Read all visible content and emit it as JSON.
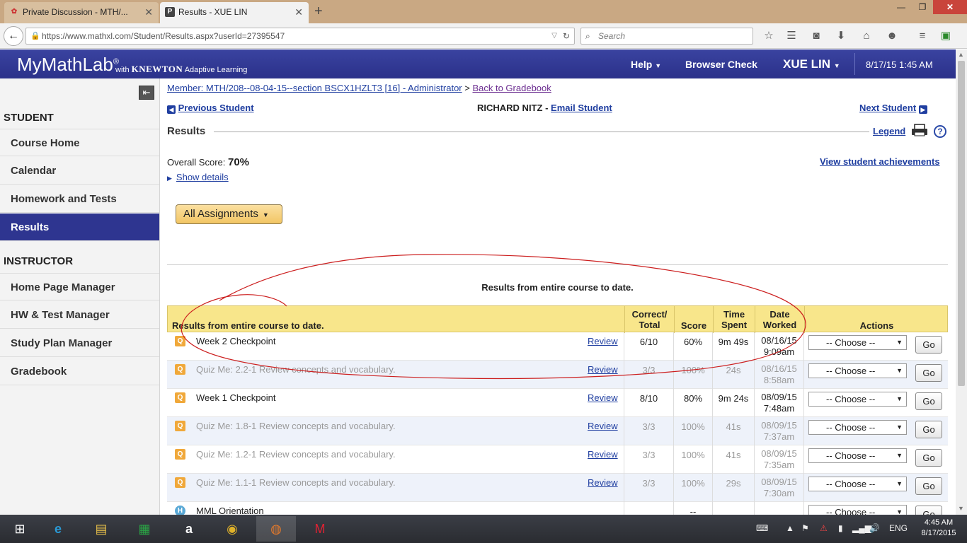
{
  "browser": {
    "tabs": [
      {
        "label": "Private Discussion - MTH/..."
      },
      {
        "label": "Results - XUE LIN"
      }
    ],
    "url": "https://www.mathxl.com/Student/Results.aspx?userId=27395547",
    "search_placeholder": "Search"
  },
  "header": {
    "logo": "MyMathLab",
    "logo_reg": "®",
    "logo_with": "with",
    "logo_knewton": "KNEWTON",
    "logo_adaptive": "Adaptive Learning",
    "help": "Help",
    "browser_check": "Browser Check",
    "user": "XUE LIN",
    "datetime": "8/17/15 1:45 AM"
  },
  "sidebar": {
    "student_title": "STUDENT",
    "student_items": [
      {
        "label": "Course Home"
      },
      {
        "label": "Calendar"
      },
      {
        "label": "Homework and Tests"
      },
      {
        "label": "Results"
      }
    ],
    "instructor_title": "INSTRUCTOR",
    "instructor_items": [
      {
        "label": "Home Page Manager"
      },
      {
        "label": "HW & Test Manager"
      },
      {
        "label": "Study Plan Manager"
      },
      {
        "label": "Gradebook"
      }
    ]
  },
  "main": {
    "member_link": "Member: MTH/208--08-04-15--section BSCX1HZLT3 [16] - Administrator",
    "member_sep": ">",
    "back_link": "Back to Gradebook",
    "prev_student": "Previous Student",
    "student_name": "RICHARD NITZ",
    "name_sep": "-",
    "email_student": "Email Student",
    "next_student": "Next Student",
    "title": "Results",
    "legend": "Legend",
    "overall_label": "Overall Score:",
    "overall_value": "70%",
    "achievements": "View student achievements",
    "show_details": "Show details",
    "assignments_btn": "All Assignments",
    "caption": "Results from entire course to date."
  },
  "table": {
    "headers": {
      "name": "Results from entire course to date.",
      "correct": "Correct/ Total",
      "score": "Score",
      "time": "Time Spent",
      "date": "Date Worked",
      "actions": "Actions"
    },
    "review_label": "Review",
    "choose_label": "-- Choose --",
    "go_label": "Go",
    "rows": [
      {
        "icon": "Q",
        "name": "Week 2 Checkpoint",
        "correct": "6/10",
        "score": "60%",
        "time": "9m 49s",
        "date1": "08/16/15",
        "date2": "9:09am"
      },
      {
        "icon": "Q",
        "name": "Quiz Me: 2.2-1 Review concepts and vocabulary.",
        "correct": "3/3",
        "score": "100%",
        "time": "24s",
        "date1": "08/16/15",
        "date2": "8:58am"
      },
      {
        "icon": "Q",
        "name": "Week 1 Checkpoint",
        "correct": "8/10",
        "score": "80%",
        "time": "9m 24s",
        "date1": "08/09/15",
        "date2": "7:48am"
      },
      {
        "icon": "Q",
        "name": "Quiz Me: 1.8-1 Review concepts and vocabulary.",
        "correct": "3/3",
        "score": "100%",
        "time": "41s",
        "date1": "08/09/15",
        "date2": "7:37am"
      },
      {
        "icon": "Q",
        "name": "Quiz Me: 1.2-1 Review concepts and vocabulary.",
        "correct": "3/3",
        "score": "100%",
        "time": "41s",
        "date1": "08/09/15",
        "date2": "7:35am"
      },
      {
        "icon": "Q",
        "name": "Quiz Me: 1.1-1 Review concepts and vocabulary.",
        "correct": "3/3",
        "score": "100%",
        "time": "29s",
        "date1": "08/09/15",
        "date2": "7:30am"
      },
      {
        "icon": "H",
        "name": "MML Orientation",
        "correct": "",
        "score": "--",
        "time": "",
        "date1": "",
        "date2": ""
      }
    ]
  },
  "taskbar": {
    "lang": "ENG",
    "time": "4:45 AM",
    "date": "8/17/2015"
  },
  "colors": {
    "header_blue": "#2e3590",
    "table_header": "#f8e68b",
    "annotation": "#cc1f1f"
  }
}
